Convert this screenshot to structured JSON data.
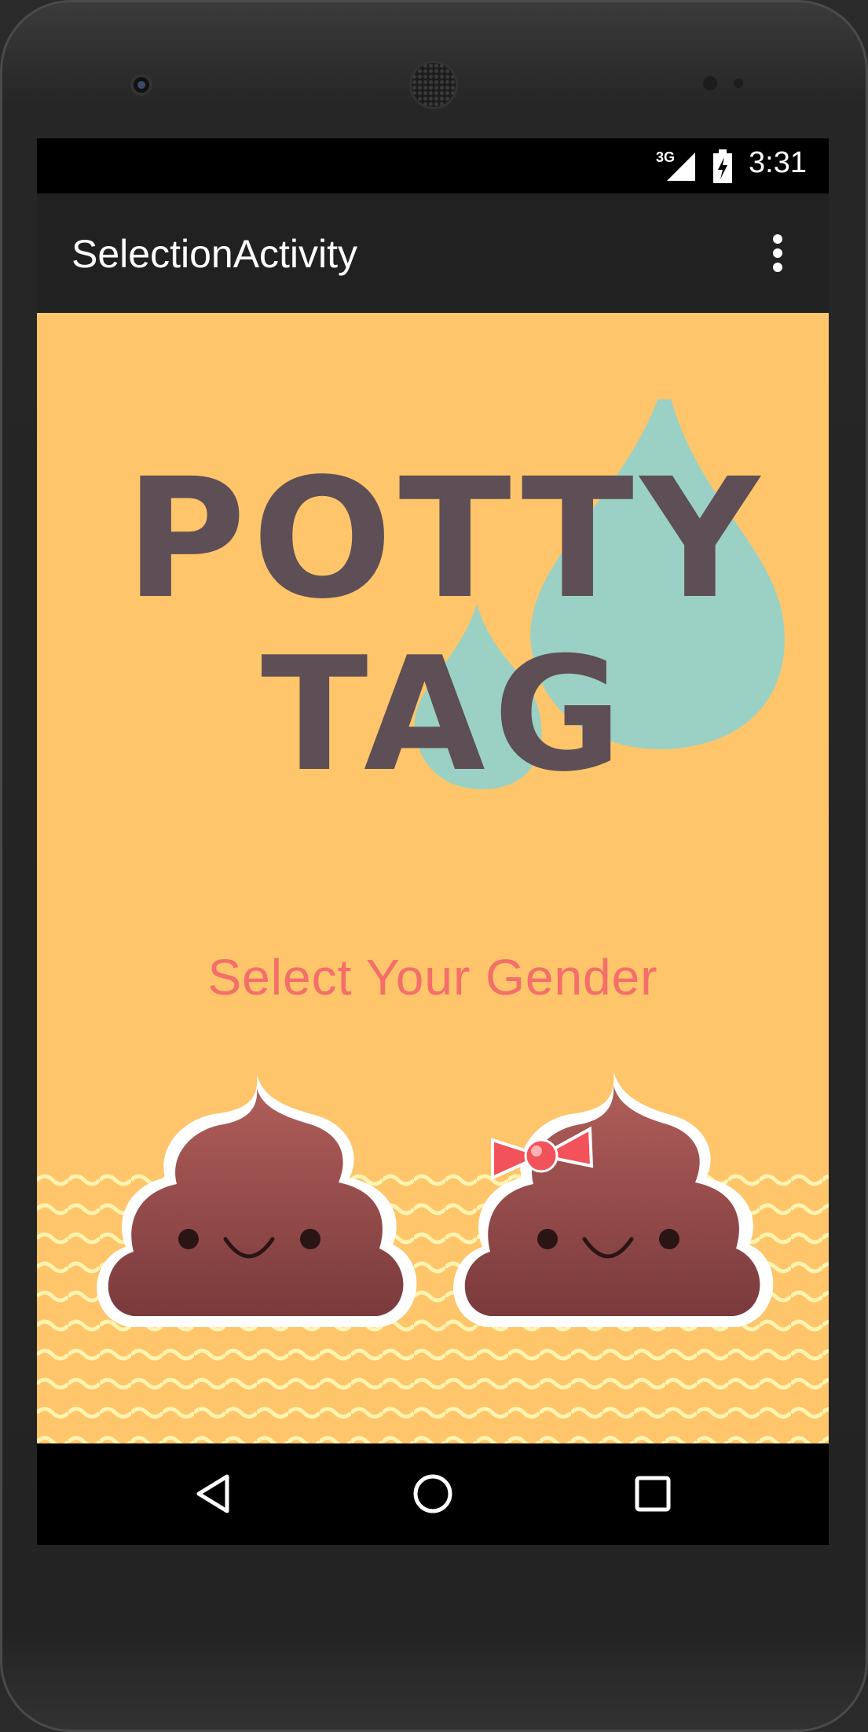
{
  "status_bar": {
    "network": "3G",
    "time": "3:31"
  },
  "app_bar": {
    "title": "SelectionActivity",
    "overflow_icon": "more-vert-icon"
  },
  "logo": {
    "line1": "POTTY",
    "line2": "TAG"
  },
  "selection": {
    "prompt": "Select Your Gender",
    "options": [
      {
        "name": "boy-poop",
        "icon": "poop-character-icon"
      },
      {
        "name": "girl-poop",
        "icon": "poop-character-with-bow-icon"
      }
    ]
  },
  "nav_bar": {
    "back_icon": "back-triangle-icon",
    "home_icon": "home-circle-icon",
    "recents_icon": "recents-square-icon"
  },
  "colors": {
    "background": "#fec56b",
    "logo_text": "#5e4e55",
    "drops": "#9bd1c4",
    "prompt": "#f46e6a",
    "poop_top": "#b05e5a",
    "poop_bottom": "#7a3a3c",
    "bow": "#f2535a",
    "waves": "#fff4b0"
  }
}
